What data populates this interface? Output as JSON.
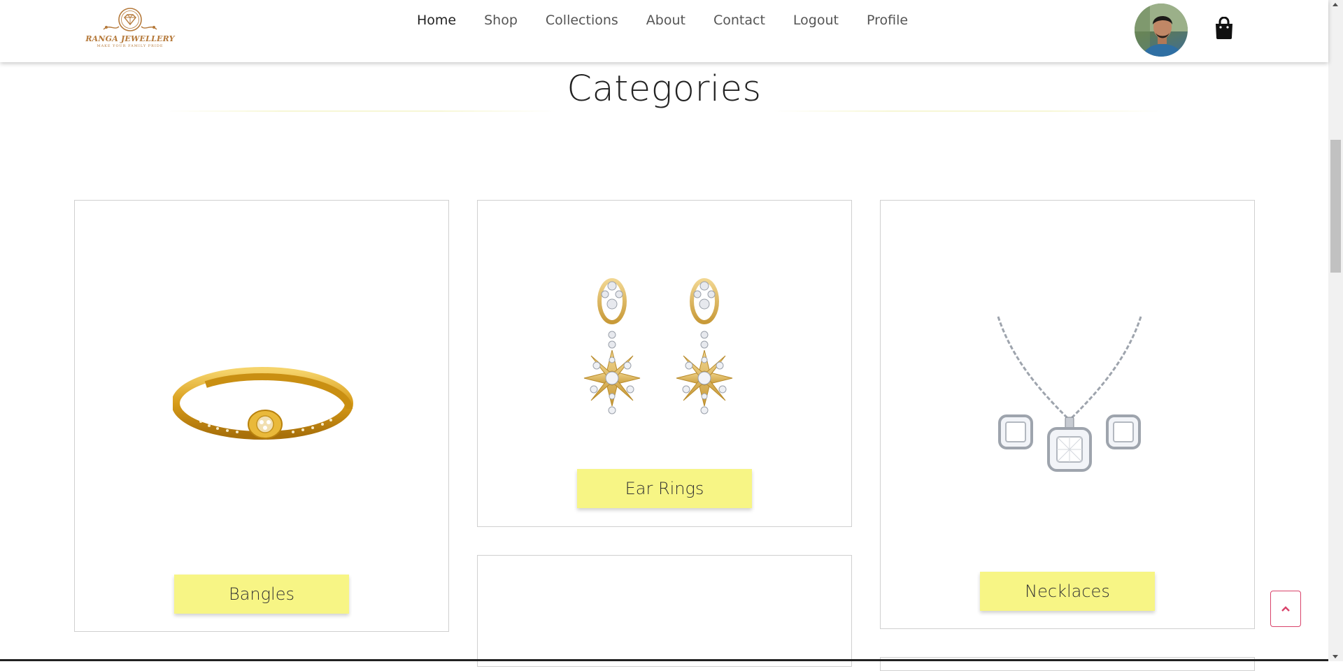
{
  "brand": {
    "name": "RANGA JEWELLERY",
    "tagline": "MAKE YOUR FAMILY PRIDE",
    "color": "#b5793a"
  },
  "nav": {
    "items": [
      {
        "label": "Home",
        "active": true
      },
      {
        "label": "Shop"
      },
      {
        "label": "Collections"
      },
      {
        "label": "About"
      },
      {
        "label": "Contact"
      },
      {
        "label": "Logout"
      },
      {
        "label": "Profile"
      }
    ]
  },
  "header_icons": {
    "avatar": "user-avatar",
    "cart": "shopping-bag-icon"
  },
  "page": {
    "title": "Categories"
  },
  "categories": [
    {
      "label": "Bangles",
      "image": "gold-bangle"
    },
    {
      "label": "Ear Rings",
      "image": "gold-diamond-earrings"
    },
    {
      "label": "Necklaces",
      "image": "silver-pendant-necklace-set"
    }
  ],
  "colors": {
    "button_bg": "#f7f585",
    "scroll_top_accent": "#d9436b"
  },
  "scroll_top": {
    "icon": "chevron-up-icon"
  }
}
